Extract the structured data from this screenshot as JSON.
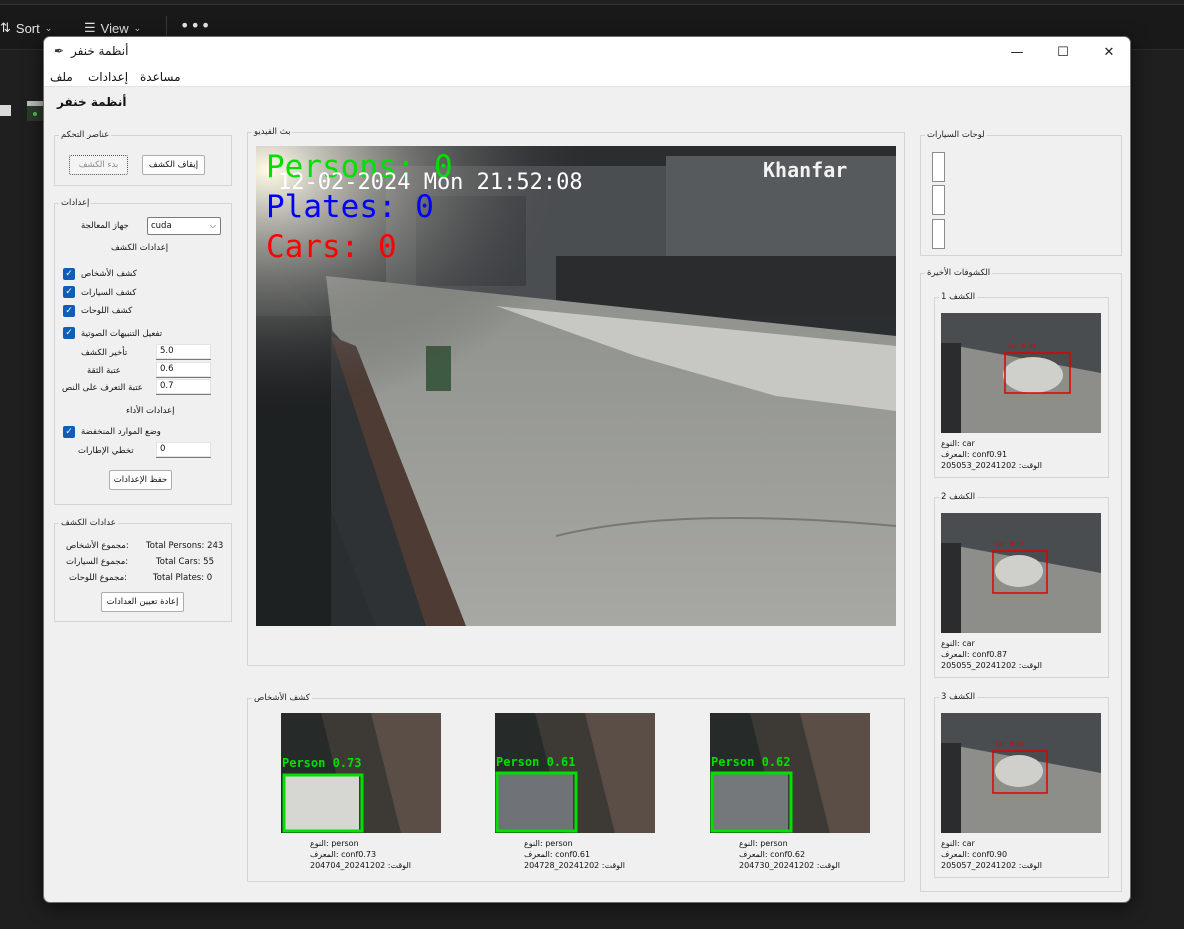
{
  "background": {
    "sort_label": "Sort",
    "view_label": "View",
    "more_label": "•••"
  },
  "window": {
    "title": "أنظمة خنفر",
    "minimize": "—",
    "maximize": "☐",
    "close": "✕"
  },
  "menu": {
    "file": "ملف",
    "settings": "إعدادات",
    "help": "مساعدة"
  },
  "app_title": "أنظمة خنفر",
  "controls": {
    "title": "عناصر التحكم",
    "start_label": "بدء الكشف",
    "stop_label": "إيقاف الكشف"
  },
  "settings": {
    "title": "إعدادات",
    "device_label": "جهاز المعالجة",
    "device_value": "cuda",
    "detection_settings_title": "إعدادات الكشف",
    "detect_persons": "كشف الأشخاص",
    "detect_cars": "كشف السيارات",
    "detect_plates": "كشف اللوحات",
    "sound_alerts": "تفعيل التنبيهات الصوتية",
    "delay_label": "تأخير الكشف",
    "delay_value": "5.0",
    "confidence_label": "عتبة الثقة",
    "confidence_value": "0.6",
    "ocr_label": "عتبة التعرف على النص",
    "ocr_value": "0.7",
    "performance_title": "إعدادات الأداء",
    "low_resource": "وضع الموارد المنخفضة",
    "frame_skip_label": "تخطي الإطارات",
    "frame_skip_value": "0",
    "save_label": "حفظ الإعدادات"
  },
  "counters": {
    "title": "عدادات الكشف",
    "persons_label": "مجموع الأشخاص:",
    "persons_value": "Total Persons: 243",
    "cars_label": "مجموع السيارات:",
    "cars_value": "Total Cars: 55",
    "plates_label": "مجموع اللوحات:",
    "plates_value": "Total Plates: 0",
    "reset_label": "إعادة تعيين العدادات"
  },
  "video": {
    "title": "بث الفيديو",
    "persons": "Persons: 0",
    "plates": "Plates: 0",
    "cars": "Cars: 0",
    "timestamp": "12-02-2024 Mon 21:52:08",
    "watermark": "Khanfar",
    "colors": {
      "persons": "#00e000",
      "plates": "#0000ff",
      "cars": "#ff0000"
    }
  },
  "persons_panel": {
    "title": "كشف الأشخاص",
    "items": [
      {
        "overlay": "Person 0.73",
        "type": "النوع: person",
        "id": "المعرف: conf0.73",
        "time": "الوقت: 20241202_204704"
      },
      {
        "overlay": "Person 0.61",
        "type": "النوع: person",
        "id": "المعرف: conf0.61",
        "time": "الوقت: 20241202_204728"
      },
      {
        "overlay": "Person 0.62",
        "type": "النوع: person",
        "id": "المعرف: conf0.62",
        "time": "الوقت: 20241202_204730"
      }
    ]
  },
  "plates_panel": {
    "title": "لوحات السيارات"
  },
  "recent": {
    "title": "الكشوفات الأخيرة",
    "items": [
      {
        "title": "الكشف 1",
        "overlay": "car 0.91",
        "type": "النوع: car",
        "id": "المعرف: conf0.91",
        "time": "الوقت: 20241202_205053"
      },
      {
        "title": "الكشف 2",
        "overlay": "car 0.87",
        "type": "النوع: car",
        "id": "المعرف: conf0.87",
        "time": "الوقت: 20241202_205055"
      },
      {
        "title": "الكشف 3",
        "overlay": "car 0.90",
        "type": "النوع: car",
        "id": "المعرف: conf0.90",
        "time": "الوقت: 20241202_205057"
      }
    ]
  }
}
